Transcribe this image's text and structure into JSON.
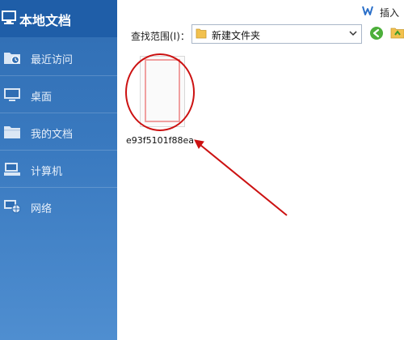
{
  "sidebar": {
    "title": "本地文档",
    "items": [
      {
        "label": "最近访问",
        "icon": "recent-folder-icon"
      },
      {
        "label": "桌面",
        "icon": "desktop-icon"
      },
      {
        "label": "我的文档",
        "icon": "folder-icon"
      },
      {
        "label": "计算机",
        "icon": "computer-icon"
      },
      {
        "label": "网络",
        "icon": "network-icon"
      }
    ]
  },
  "header": {
    "insert_label": "插入",
    "app_logo": "wps-logo-icon"
  },
  "toolbar": {
    "scope_label": "查找范围(I)：",
    "scope_value": "新建文件夹",
    "back_icon": "back-arrow-icon",
    "up_icon": "up-folder-icon"
  },
  "files": [
    {
      "name": "e93f5101f88ea"
    }
  ],
  "annotations": {
    "circle_color": "#cc1111",
    "arrow_color": "#cc1111"
  },
  "colors": {
    "sidebar_top": "#1f5ea8",
    "sidebar_body": "#3a7ac0"
  }
}
